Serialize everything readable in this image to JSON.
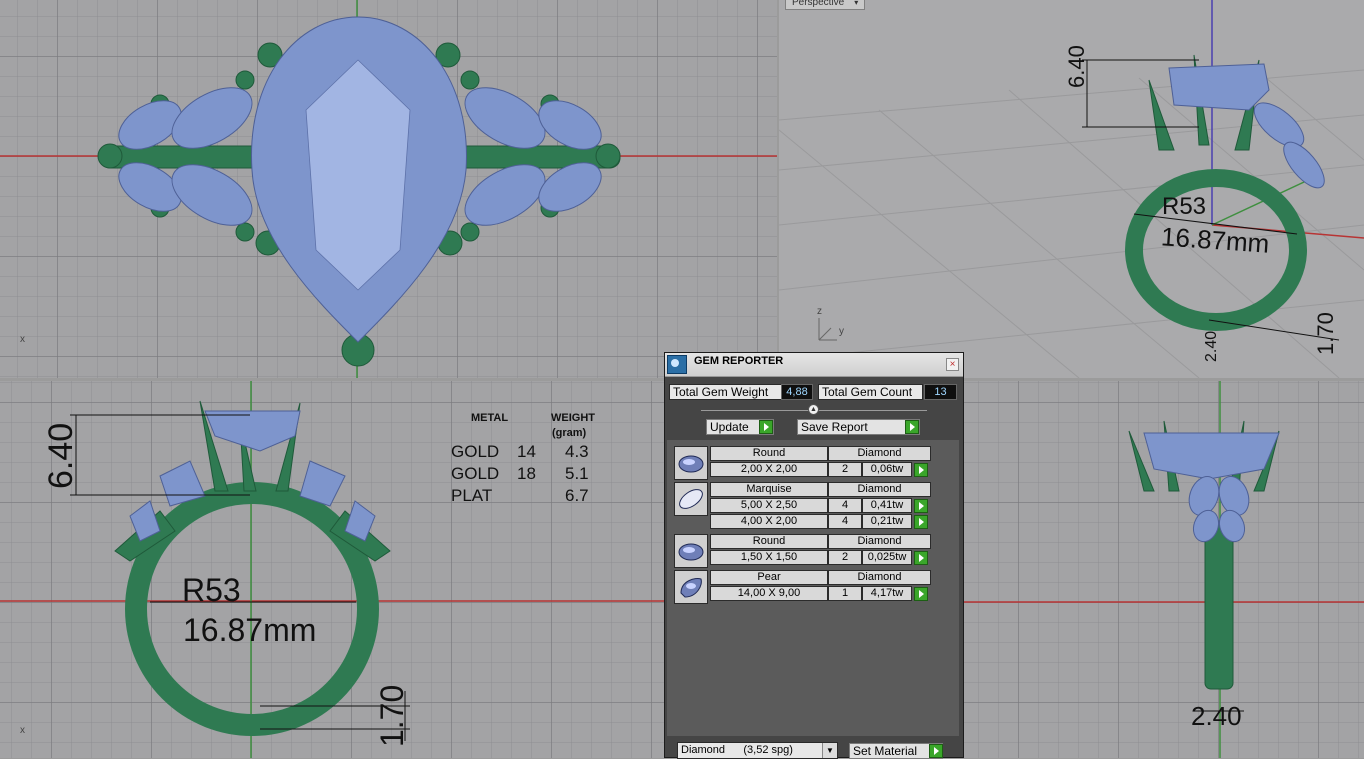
{
  "viewports": {
    "perspective": {
      "label": "Perspective"
    }
  },
  "axes": {
    "x": "x",
    "z": "z",
    "y": "y"
  },
  "dims": {
    "height": "6.40",
    "ring_size": "R53",
    "diameter": "16.87mm",
    "thickness": "1.70",
    "width": "2.40"
  },
  "weights_table": {
    "col_metal": "METAL",
    "col_weight": "WEIGHT",
    "col_unit": "(gram)",
    "rows": [
      {
        "metal": "GOLD",
        "karat": "14",
        "weight": "4.3"
      },
      {
        "metal": "GOLD",
        "karat": "18",
        "weight": "5.1"
      },
      {
        "metal": "PLAT",
        "karat": "",
        "weight": "6.7"
      }
    ]
  },
  "gem_reporter": {
    "title": "GEM REPORTER",
    "close": "×",
    "total_weight_label": "Total Gem Weight",
    "total_weight_value": "4,88",
    "total_count_label": "Total Gem Count",
    "total_count_value": "13",
    "update_label": "Update",
    "save_label": "Save Report",
    "groups": [
      {
        "shape": "Round",
        "material": "Diamond",
        "icon": "round-gem-icon",
        "rows": [
          {
            "size": "2,00 X 2,00",
            "count": "2",
            "tw": "0,06tw"
          }
        ]
      },
      {
        "shape": "Marquise",
        "material": "Diamond",
        "icon": "marquise-gem-icon",
        "rows": [
          {
            "size": "5,00 X 2,50",
            "count": "4",
            "tw": "0,41tw"
          },
          {
            "size": "4,00 X 2,00",
            "count": "4",
            "tw": "0,21tw"
          }
        ]
      },
      {
        "shape": "Round",
        "material": "Diamond",
        "icon": "round-gem-icon",
        "rows": [
          {
            "size": "1,50 X 1,50",
            "count": "2",
            "tw": "0,025tw"
          }
        ]
      },
      {
        "shape": "Pear",
        "material": "Diamond",
        "icon": "pear-gem-icon",
        "rows": [
          {
            "size": "14,00 X 9,00",
            "count": "1",
            "tw": "4,17tw"
          }
        ]
      }
    ],
    "material_select": "Diamond      (3,52 spg)",
    "set_material_label": "Set Material"
  },
  "colors": {
    "metal": "#2f7a52",
    "gem": "#7e95cc",
    "axis_red": "#b83434",
    "axis_green": "#3f8f3f",
    "panel_bg": "#454545",
    "value_text": "#9fd7ff"
  }
}
